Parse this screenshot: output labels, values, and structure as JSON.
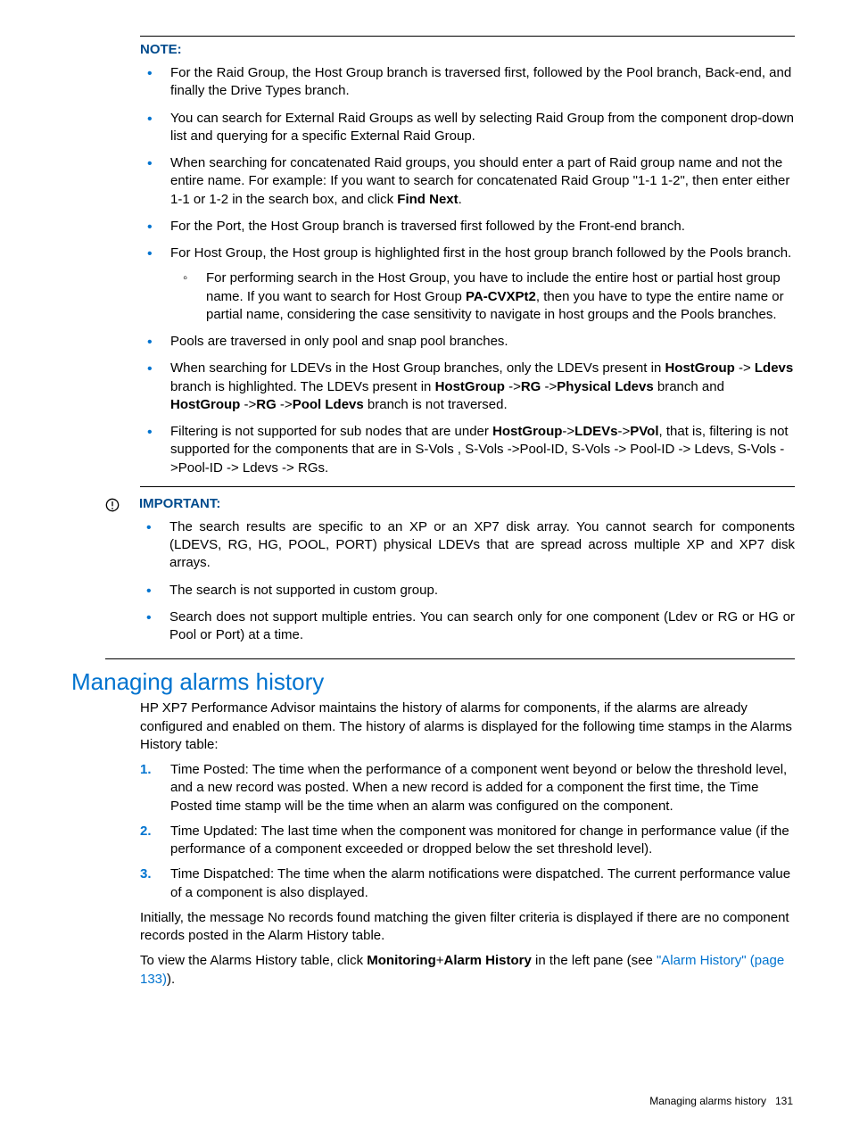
{
  "note": {
    "heading": "NOTE:",
    "items": [
      {
        "html": "For the Raid Group, the Host Group branch is traversed first, followed by the Pool branch, Back-end, and finally the Drive Types branch."
      },
      {
        "html": "You can search for External Raid Groups as well by selecting Raid Group from the component drop-down list and querying for a specific External Raid Group."
      },
      {
        "html": "When searching for concatenated Raid groups, you should enter a part of Raid group name and not the entire name. For example: If you want to search for concatenated Raid Group \"1-1 1-2\", then enter either 1-1 or 1-2 in the search box, and click <b>Find Next</b>."
      },
      {
        "html": "For the Port, the Host Group branch is traversed first followed by the Front-end branch."
      },
      {
        "html": "For Host Group, the Host group is highlighted first in the host group branch followed by the Pools branch.",
        "sub": [
          {
            "html": "For performing search in the Host Group, you have to include the entire host or partial host group name. If you want to search for Host Group <b>PA-CVXPt2</b>, then you have to type the entire name or partial name, considering the case sensitivity to navigate in host groups and the Pools branches."
          }
        ]
      },
      {
        "html": "Pools are traversed in only pool and snap pool branches."
      },
      {
        "html": "When searching for LDEVs in the Host Group branches, only the LDEVs present in <b>HostGroup</b> -> <b>Ldevs</b> branch is highlighted. The LDEVs present in <b>HostGroup</b> -><b>RG</b> -><b>Physical Ldevs</b> branch and <b>HostGroup</b> -><b>RG</b> -><b>Pool Ldevs</b> branch is not traversed."
      },
      {
        "html": "Filtering is not supported for sub nodes that are under <b>HostGroup</b>-><b>LDEVs</b>-><b>PVol</b>, that is, filtering is not supported for the components that are in S-Vols , S-Vols ->Pool-ID, S-Vols -> Pool-ID -> Ldevs, S-Vols ->Pool-ID -> Ldevs -> RGs."
      }
    ]
  },
  "important": {
    "heading": "IMPORTANT:",
    "items": [
      {
        "html": "The search results are specific to an XP or an XP7 disk array. You cannot search for components (LDEVS, RG, HG, POOL, PORT) physical LDEVs that are spread across multiple XP and XP7 disk arrays."
      },
      {
        "html": "The search is not supported in custom group."
      },
      {
        "html": "Search does not support multiple entries. You can search only for one component (Ldev or RG or HG or Pool or Port) at a time."
      }
    ]
  },
  "section": {
    "heading": "Managing alarms history",
    "para1": "HP XP7 Performance Advisor maintains the history of alarms for components, if the alarms are already configured and enabled on them. The history of alarms is displayed for the following time stamps in the Alarms History table:",
    "list": [
      {
        "html": "Time Posted: The time when the performance of a component went beyond or below the threshold level, and a new record was posted. When a new record is added for a component the first time, the Time Posted time stamp will be the time when an alarm was configured on the component."
      },
      {
        "html": "Time Updated: The last time when the component was monitored for change in performance value (if the performance of a component exceeded or dropped below the set threshold level)."
      },
      {
        "html": "Time Dispatched: The time when the alarm notifications were dispatched. The current performance value of a component is also displayed."
      }
    ],
    "para2": "Initially, the message No records found matching the given filter criteria is displayed if there are no component records posted in the Alarm History table.",
    "para3_html": "To view the Alarms History table, click <b>Monitoring</b>+<b>Alarm History</b> in the left pane (see <span class='link'>\"Alarm History\" (page 133)</span>)."
  },
  "footer": {
    "text": "Managing alarms history",
    "page": "131"
  }
}
